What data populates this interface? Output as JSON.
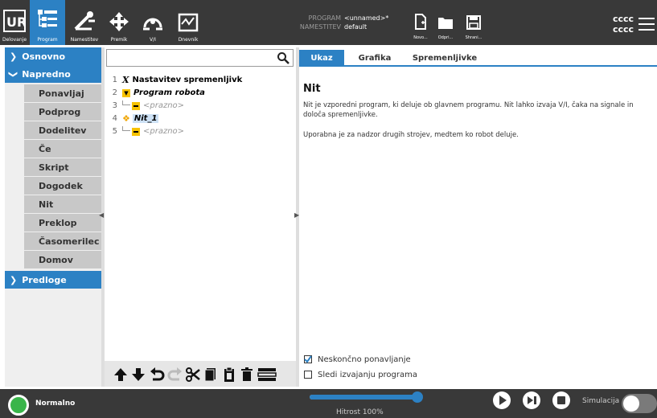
{
  "topbar": {
    "nav": [
      {
        "label": "Delovanje"
      },
      {
        "label": "Program"
      },
      {
        "label": "Namestitev"
      },
      {
        "label": "Premik"
      },
      {
        "label": "V/I"
      },
      {
        "label": "Dnevnik"
      }
    ],
    "program_key": "PROGRAM",
    "program_val": "<unnamed>*",
    "install_key": "NAMESTITEV",
    "install_val": "default",
    "file_buttons": [
      {
        "label": "Novo..."
      },
      {
        "label": "Odpri..."
      },
      {
        "label": "Shrani..."
      }
    ],
    "user_line1": "cccc",
    "user_line2": "cccc"
  },
  "left": {
    "categories": [
      {
        "label": "Osnovno"
      },
      {
        "label": "Napredno"
      },
      {
        "label": "Predloge"
      }
    ],
    "items": [
      {
        "label": "Ponavljaj"
      },
      {
        "label": "Podprog"
      },
      {
        "label": "Dodelitev"
      },
      {
        "label": "Če"
      },
      {
        "label": "Skript"
      },
      {
        "label": "Dogodek"
      },
      {
        "label": "Nit"
      },
      {
        "label": "Preklop"
      },
      {
        "label": "Časomerilec"
      },
      {
        "label": "Domov"
      }
    ]
  },
  "tree": {
    "rows": [
      {
        "num": "1",
        "text": "Nastavitev spremenljivk"
      },
      {
        "num": "2",
        "text": "Program robota"
      },
      {
        "num": "3",
        "text": "<prazno>"
      },
      {
        "num": "4",
        "text": "Nit_1"
      },
      {
        "num": "5",
        "text": "<prazno>"
      }
    ]
  },
  "right": {
    "tabs": [
      {
        "label": "Ukaz"
      },
      {
        "label": "Grafika"
      },
      {
        "label": "Spremenljivke"
      }
    ],
    "title": "Nit",
    "desc1": "Nit je vzporedni program, ki deluje ob glavnem programu. Nit lahko izvaja V/I, čaka na signale in določa spremenljivke.",
    "desc2": "Uporabna je za nadzor drugih strojev, medtem ko robot deluje.",
    "check1": {
      "label": "Neskončno ponavljanje",
      "checked": true
    },
    "check2": {
      "label": "Sledi izvajanju programa",
      "checked": false
    }
  },
  "bottom": {
    "status": "Normalno",
    "speed_label": "Hitrost 100%",
    "speed_value": 1.0,
    "sim_label": "Simulacija"
  },
  "colors": {
    "accent": "#2c81c4",
    "dark": "#393939",
    "status": "#39b54a",
    "thread": "#f0a500"
  }
}
